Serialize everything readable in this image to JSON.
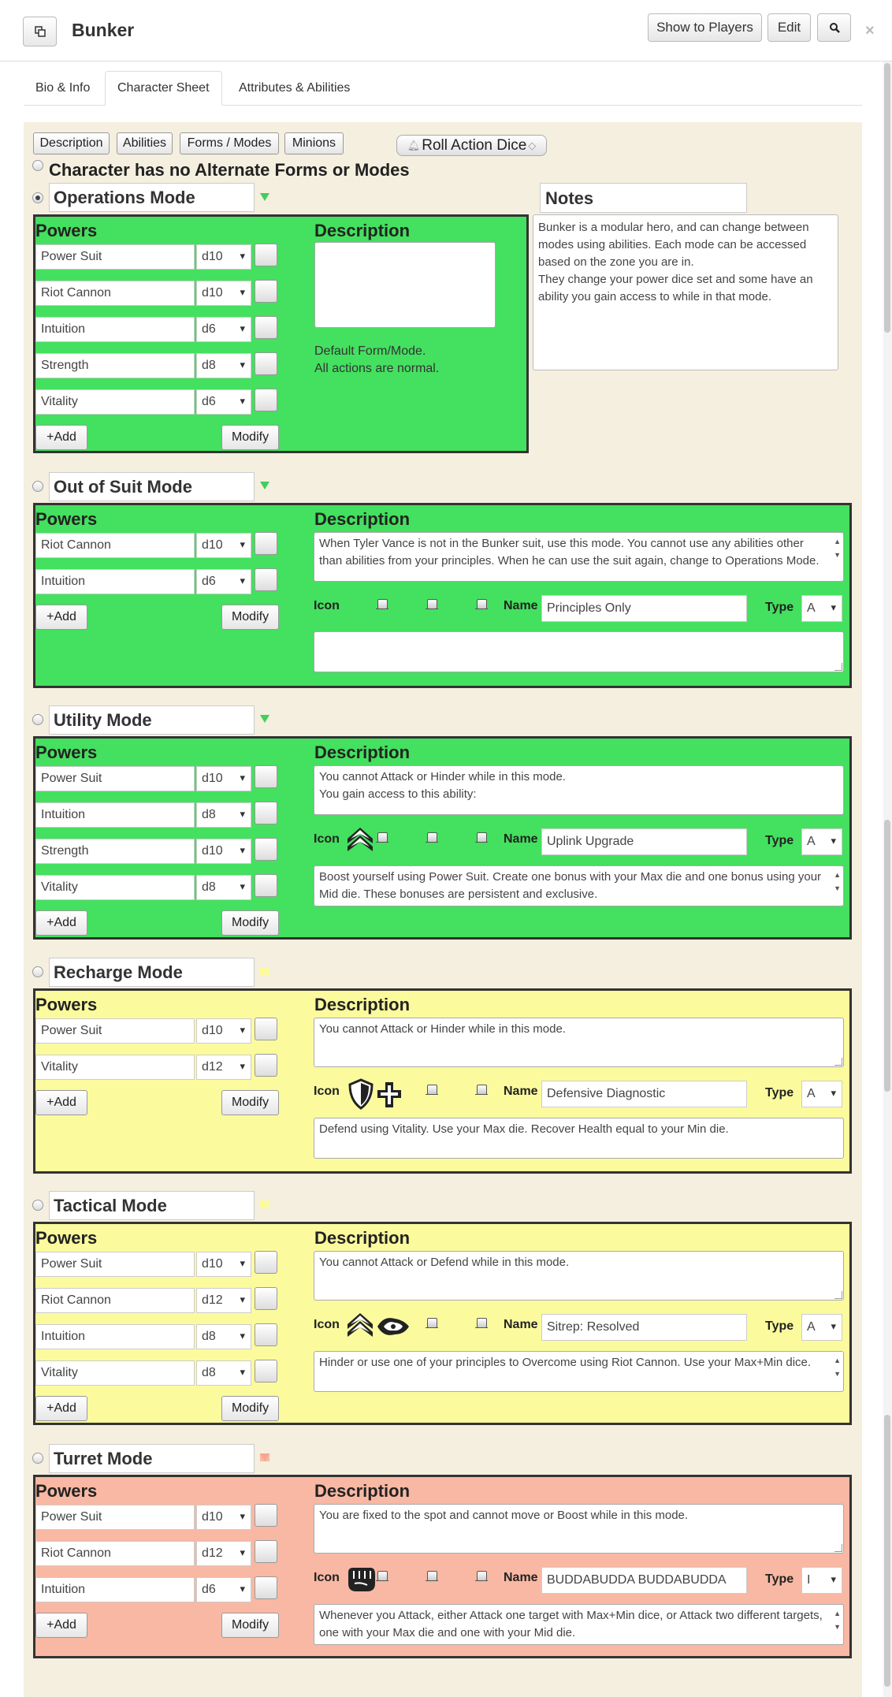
{
  "window": {
    "title": "Bunker",
    "buttons": {
      "show_to_players": "Show to Players",
      "edit": "Edit"
    },
    "close": "×"
  },
  "tabs": [
    "Bio & Info",
    "Character Sheet",
    "Attributes & Abilities"
  ],
  "subnav": [
    "Description",
    "Abilities",
    "Forms / Modes",
    "Minions"
  ],
  "roll_button": "Roll Action Dice",
  "no_alt_forms": "Character has no Alternate Forms or Modes",
  "labels": {
    "powers": "Powers",
    "description": "Description",
    "add": "+Add",
    "modify": "Modify",
    "icon": "Icon",
    "name": "Name",
    "type": "Type"
  },
  "notes": {
    "label": "Notes",
    "text": "Bunker is a modular hero, and can change between modes using abilities. Each mode can be accessed based on the zone you are in.\nThey change your power dice set and some have an ability you gain access to while in that mode."
  },
  "modes": [
    {
      "name": "Operations Mode",
      "color": "#44e05f",
      "selected": true,
      "powers": [
        {
          "name": "Power Suit",
          "die": "d10"
        },
        {
          "name": "Riot Cannon",
          "die": "d10"
        },
        {
          "name": "Intuition",
          "die": "d6"
        },
        {
          "name": "Strength",
          "die": "d8"
        },
        {
          "name": "Vitality",
          "die": "d6"
        }
      ],
      "description": "",
      "default_note": "Default Form/Mode.\nAll actions are normal."
    },
    {
      "name": "Out of Suit Mode",
      "color": "#44e05f",
      "selected": false,
      "powers": [
        {
          "name": "Riot Cannon",
          "die": "d10"
        },
        {
          "name": "Intuition",
          "die": "d6"
        }
      ],
      "description": "When Tyler Vance is not in the Bunker suit, use this mode. You cannot use any abilities other than abilities from your principles. When he can use the suit again, change to Operations Mode.",
      "ability": {
        "name": "Principles Only",
        "type": "A",
        "icons": [],
        "text": ""
      }
    },
    {
      "name": "Utility Mode",
      "color": "#44e05f",
      "selected": false,
      "powers": [
        {
          "name": "Power Suit",
          "die": "d10"
        },
        {
          "name": "Intuition",
          "die": "d8"
        },
        {
          "name": "Strength",
          "die": "d10"
        },
        {
          "name": "Vitality",
          "die": "d8"
        }
      ],
      "description": "You cannot Attack or Hinder while in this mode.\nYou gain access to this ability:",
      "ability": {
        "name": "Uplink Upgrade",
        "type": "A",
        "icons": [
          "boost-icon"
        ],
        "text": "Boost yourself using Power Suit. Create one bonus with your Max die and one bonus using your Mid die. These bonuses are persistent and exclusive."
      }
    },
    {
      "name": "Recharge Mode",
      "color": "#fbfb9e",
      "selected": false,
      "powers": [
        {
          "name": "Power Suit",
          "die": "d10"
        },
        {
          "name": "Vitality",
          "die": "d12"
        }
      ],
      "description": "You cannot Attack or Hinder while in this mode.",
      "ability": {
        "name": "Defensive Diagnostic",
        "type": "A",
        "icons": [
          "defend-icon",
          "recover-icon"
        ],
        "text": "Defend using Vitality. Use your Max die. Recover Health equal to your Min die."
      }
    },
    {
      "name": "Tactical Mode",
      "color": "#fbfb9e",
      "selected": false,
      "powers": [
        {
          "name": "Power Suit",
          "die": "d10"
        },
        {
          "name": "Riot Cannon",
          "die": "d12"
        },
        {
          "name": "Intuition",
          "die": "d8"
        },
        {
          "name": "Vitality",
          "die": "d8"
        }
      ],
      "description": "You cannot Attack or Defend while in this mode.",
      "ability": {
        "name": "Sitrep: Resolved",
        "type": "A",
        "icons": [
          "boost-icon",
          "hinder-icon"
        ],
        "text": "Hinder or use one of your principles to Overcome using Riot Cannon. Use your Max+Min dice."
      }
    },
    {
      "name": "Turret Mode",
      "color": "#f5a592",
      "selected": false,
      "powers": [
        {
          "name": "Power Suit",
          "die": "d10"
        },
        {
          "name": "Riot Cannon",
          "die": "d12"
        },
        {
          "name": "Intuition",
          "die": "d6"
        }
      ],
      "description": "You are fixed to the spot and cannot move or Boost while in this mode.",
      "ability": {
        "name": "BUDDABUDDA BUDDABUDDA",
        "type": "I",
        "icons": [
          "attack-icon"
        ],
        "text": "Whenever you Attack, either Attack one target with Max+Min dice, or Attack two different targets, one with your Max die and one with your Mid die."
      }
    }
  ]
}
